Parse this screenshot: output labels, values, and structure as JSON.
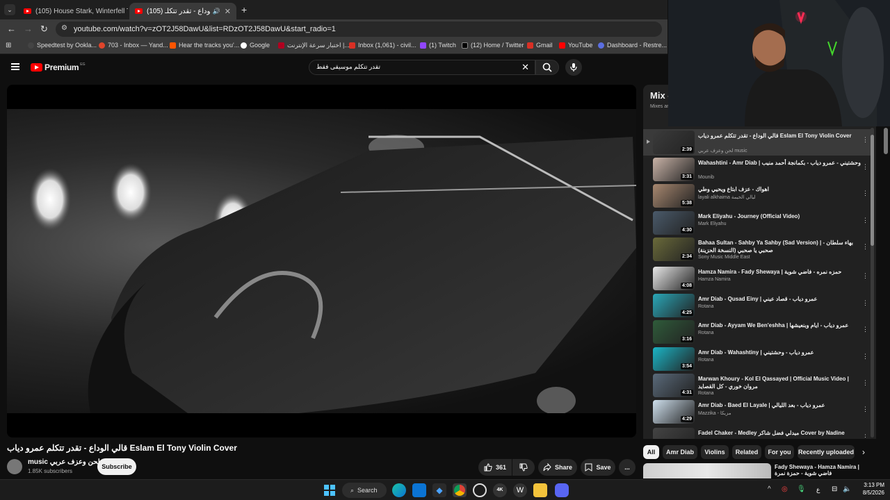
{
  "browser": {
    "tabs": [
      {
        "label": "(105) House Stark, Winterfell Th"
      },
      {
        "label": "(105) قالي الوداع - تقدر تتكلـ"
      }
    ],
    "url": "youtube.com/watch?v=zOT2J58DawU&list=RDzOT2J58DawU&start_radio=1",
    "bookmarks": [
      {
        "label": "Speedtest by Ookla...",
        "color": "#444444"
      },
      {
        "label": "703 - Inbox — Yand...",
        "color": "#e0452b"
      },
      {
        "label": "Hear the tracks you'...",
        "color": "#ff5500"
      },
      {
        "label": "Google",
        "color": "#4285f4"
      },
      {
        "label": "اختبار سرعة الإنترنت |...",
        "color": "#b00020"
      },
      {
        "label": "Inbox (1,061) - civil...",
        "color": "#d93025"
      },
      {
        "label": "(1) Twitch",
        "color": "#9146ff"
      },
      {
        "label": "(12) Home / Twitter",
        "color": "#000000"
      },
      {
        "label": "Gmail",
        "color": "#d93025"
      },
      {
        "label": "YouTube",
        "color": "#ff0000"
      },
      {
        "label": "Dashboard - Restre...",
        "color": "#5b6ee1"
      }
    ]
  },
  "youtube": {
    "logo": "Premium",
    "region": "EG",
    "search_value": "تقدر تتكلم موسيقى فقط",
    "video": {
      "title": "قالي الوداع - تقدر تتكلم عمرو دياب Eslam El Tony Violin Cover",
      "channel": "music لحن وعزف عربي",
      "subscribers": "1.85K subscribers",
      "subscribe_label": "Subscribe",
      "likes": "361",
      "share_label": "Share",
      "save_label": "Save",
      "more_label": "..."
    },
    "mix": {
      "title": "Mix -",
      "subtitle": "Mixes ar"
    },
    "playlist": [
      {
        "title": "قالي الوداع - تقدر تتكلم عمرو دياب Eslam El Tony Violin Cover",
        "channel": "لحن وعزف عربي music",
        "duration": "2:39",
        "current": true
      },
      {
        "title": "Wahashtini - Amr Diab | وحشتيني - عمرو دياب - بكمانجة أحمد منيب",
        "channel": "Mounib",
        "duration": "3:31"
      },
      {
        "title": "اهواك - عزف ابتاع ويحيي وطي",
        "channel": "layali alkhaima ليالي الخيمة",
        "duration": "5:38"
      },
      {
        "title": "Mark Eliyahu - Journey (Official Video)",
        "channel": "Mark Eliyahu",
        "duration": "4:30"
      },
      {
        "title": "Bahaa Sultan - Sahby Ya Sahby (Sad Version) | - بهاء سلطان صحبي يا صحبي (النسخة الحزينة)",
        "channel": "Sony Music Middle East",
        "duration": "2:34"
      },
      {
        "title": "Hamza Namira - Fady Shewaya | حمزه نمره - فاضي شوية",
        "channel": "Hamza Namira",
        "duration": "4:08"
      },
      {
        "title": "Amr Diab - Qusad Einy | عمرو دياب - قصاد عيني",
        "channel": "Rotana",
        "duration": "4:25"
      },
      {
        "title": "Amr Diab - Ayyam We Ben'eshha | عمرو دياب - ايام وبنعيشها",
        "channel": "Rotana",
        "duration": "3:16"
      },
      {
        "title": "Amr Diab - Wahashtiny | عمرو دياب - وحشتيني",
        "channel": "Rotana",
        "duration": "3:54"
      },
      {
        "title": "Marwan Khoury - Kol El Qassayed | Official Music Video | مروان خوري - كل القصايد",
        "channel": "Rotana",
        "duration": "4:31"
      },
      {
        "title": "Amr Diab - Baed El Layale | عمرو دياب - بعد الليالي",
        "channel": "Mazzika - مزيكا",
        "duration": "4:29"
      },
      {
        "title": "Fadel Chaker - Medley ميدلي فضل شاكر Cover by Nadine",
        "channel": "",
        "duration": ""
      }
    ],
    "chips": [
      "All",
      "Amr Diab",
      "Violins",
      "Related",
      "For you",
      "Recently uploaded"
    ],
    "rec_next_title": "Fady Shewaya - Hamza Namira | فاضي شوية - حمزة نمرة"
  },
  "taskbar": {
    "search_label": "Search",
    "time": "3:13 PM",
    "date": "8/5/2026",
    "lang": "ع",
    "accent": "#0078d4"
  }
}
